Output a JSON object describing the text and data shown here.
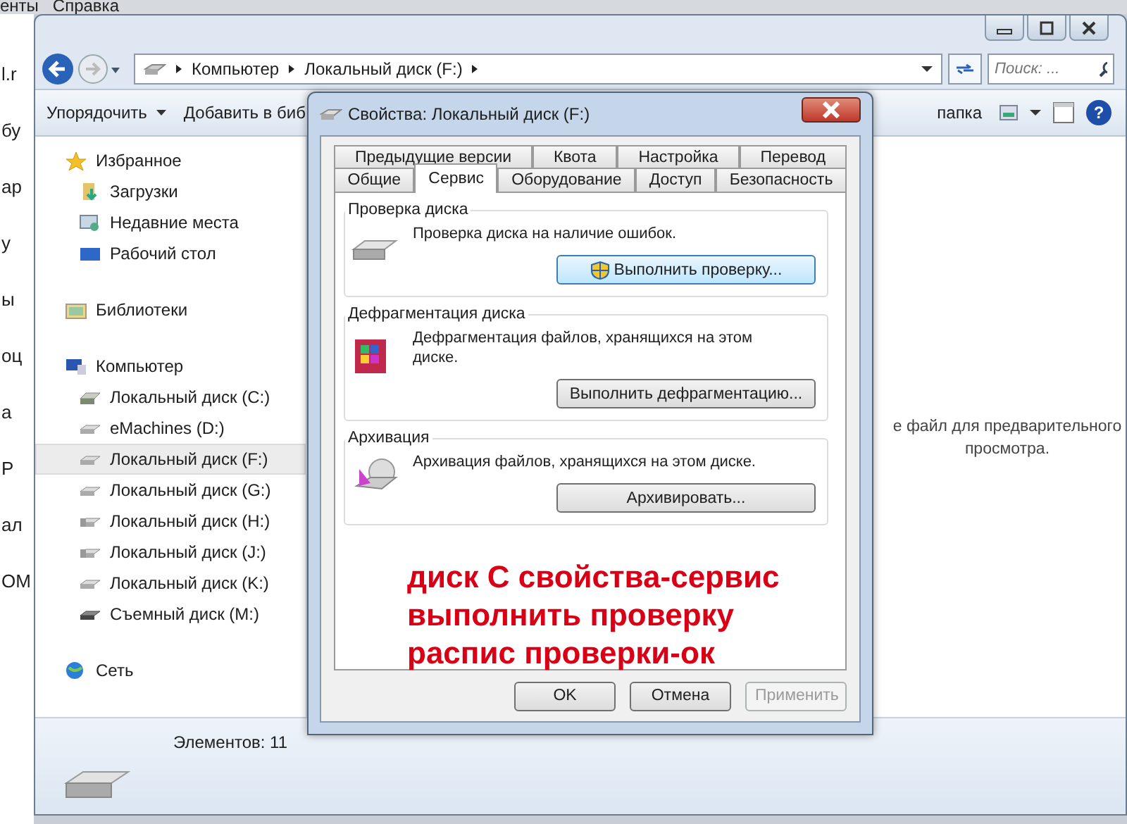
{
  "background_window": {
    "menu": [
      "енты",
      "Справка"
    ],
    "edge_fragments": [
      "l.r",
      "бу",
      "ар",
      "у",
      "ы",
      "оц",
      "а",
      "Р",
      "ал",
      "ОМ"
    ]
  },
  "explorer": {
    "address_path": [
      "Компьютер",
      "Локальный диск (F:)"
    ],
    "search": {
      "placeholder": "Поиск: ..."
    },
    "toolbar": [
      {
        "label": "Упорядочить",
        "dropdown": true
      },
      {
        "label": "Добавить в биб",
        "dropdown": false
      },
      {
        "label": "папка",
        "dropdown": false
      }
    ],
    "help_button": "?",
    "navigation": [
      {
        "label": "Избранное",
        "kind": "star",
        "selected": false,
        "children": [
          {
            "label": "Загрузки",
            "kind": "downloads",
            "selected": false
          },
          {
            "label": "Недавние места",
            "kind": "recent",
            "selected": false
          },
          {
            "label": "Рабочий стол",
            "kind": "desktop",
            "selected": false
          }
        ]
      },
      {
        "label": "Библиотеки",
        "kind": "library",
        "selected": false
      },
      {
        "label": "Компьютер",
        "kind": "computer",
        "selected": false,
        "children": [
          {
            "label": "Локальный диск (C:)",
            "kind": "system",
            "selected": false
          },
          {
            "label": "eMachines (D:)",
            "kind": "drive",
            "selected": false
          },
          {
            "label": "Локальный диск (F:)",
            "kind": "drive",
            "selected": true
          },
          {
            "label": "Локальный диск (G:)",
            "kind": "drive",
            "selected": false
          },
          {
            "label": "Локальный диск (H:)",
            "kind": "shared",
            "selected": false
          },
          {
            "label": "Локальный диск (J:)",
            "kind": "shared",
            "selected": false
          },
          {
            "label": "Локальный диск (K:)",
            "kind": "drive",
            "selected": false
          },
          {
            "label": "Съемный диск (M:)",
            "kind": "removable",
            "selected": false
          }
        ]
      },
      {
        "label": "Сеть",
        "kind": "network",
        "selected": false
      }
    ],
    "preview_message": [
      "е файл для предварительного",
      "просмотра."
    ],
    "status_bar": "Элементов: 11"
  },
  "dialog": {
    "title": "Свойства: Локальный диск (F:)",
    "tab_rows": [
      [
        {
          "label": "Предыдущие версии",
          "selected": false
        },
        {
          "label": "Квота",
          "selected": false
        },
        {
          "label": "Настройка",
          "selected": false
        },
        {
          "label": "Перевод",
          "selected": false
        }
      ],
      [
        {
          "label": "Общие",
          "selected": false
        },
        {
          "label": "Сервис",
          "selected": true
        },
        {
          "label": "Оборудование",
          "selected": false
        },
        {
          "label": "Доступ",
          "selected": false
        },
        {
          "label": "Безопасность",
          "selected": false
        }
      ]
    ],
    "groups": [
      {
        "title": "Проверка диска",
        "kind": "check",
        "text": "Проверка диска на наличие ошибок.",
        "button": "Выполнить проверку...",
        "shield": true
      },
      {
        "title": "Дефрагментация диска",
        "kind": "defrag",
        "text": "Дефрагментация файлов, хранящихся на этом диске.",
        "button": "Выполнить дефрагментацию...",
        "shield": false
      },
      {
        "title": "Архивация",
        "kind": "backup",
        "text": "Архивация файлов, хранящихся на этом диске.",
        "button": "Архивировать...",
        "shield": false
      }
    ],
    "buttons": [
      {
        "label": "OK",
        "disabled": false
      },
      {
        "label": "Отмена",
        "disabled": false
      },
      {
        "label": "Применить",
        "disabled": true
      }
    ]
  },
  "annotation": [
    "диск С свойства-сервис",
    "выполнить проверку",
    "распис проверки-ок"
  ]
}
